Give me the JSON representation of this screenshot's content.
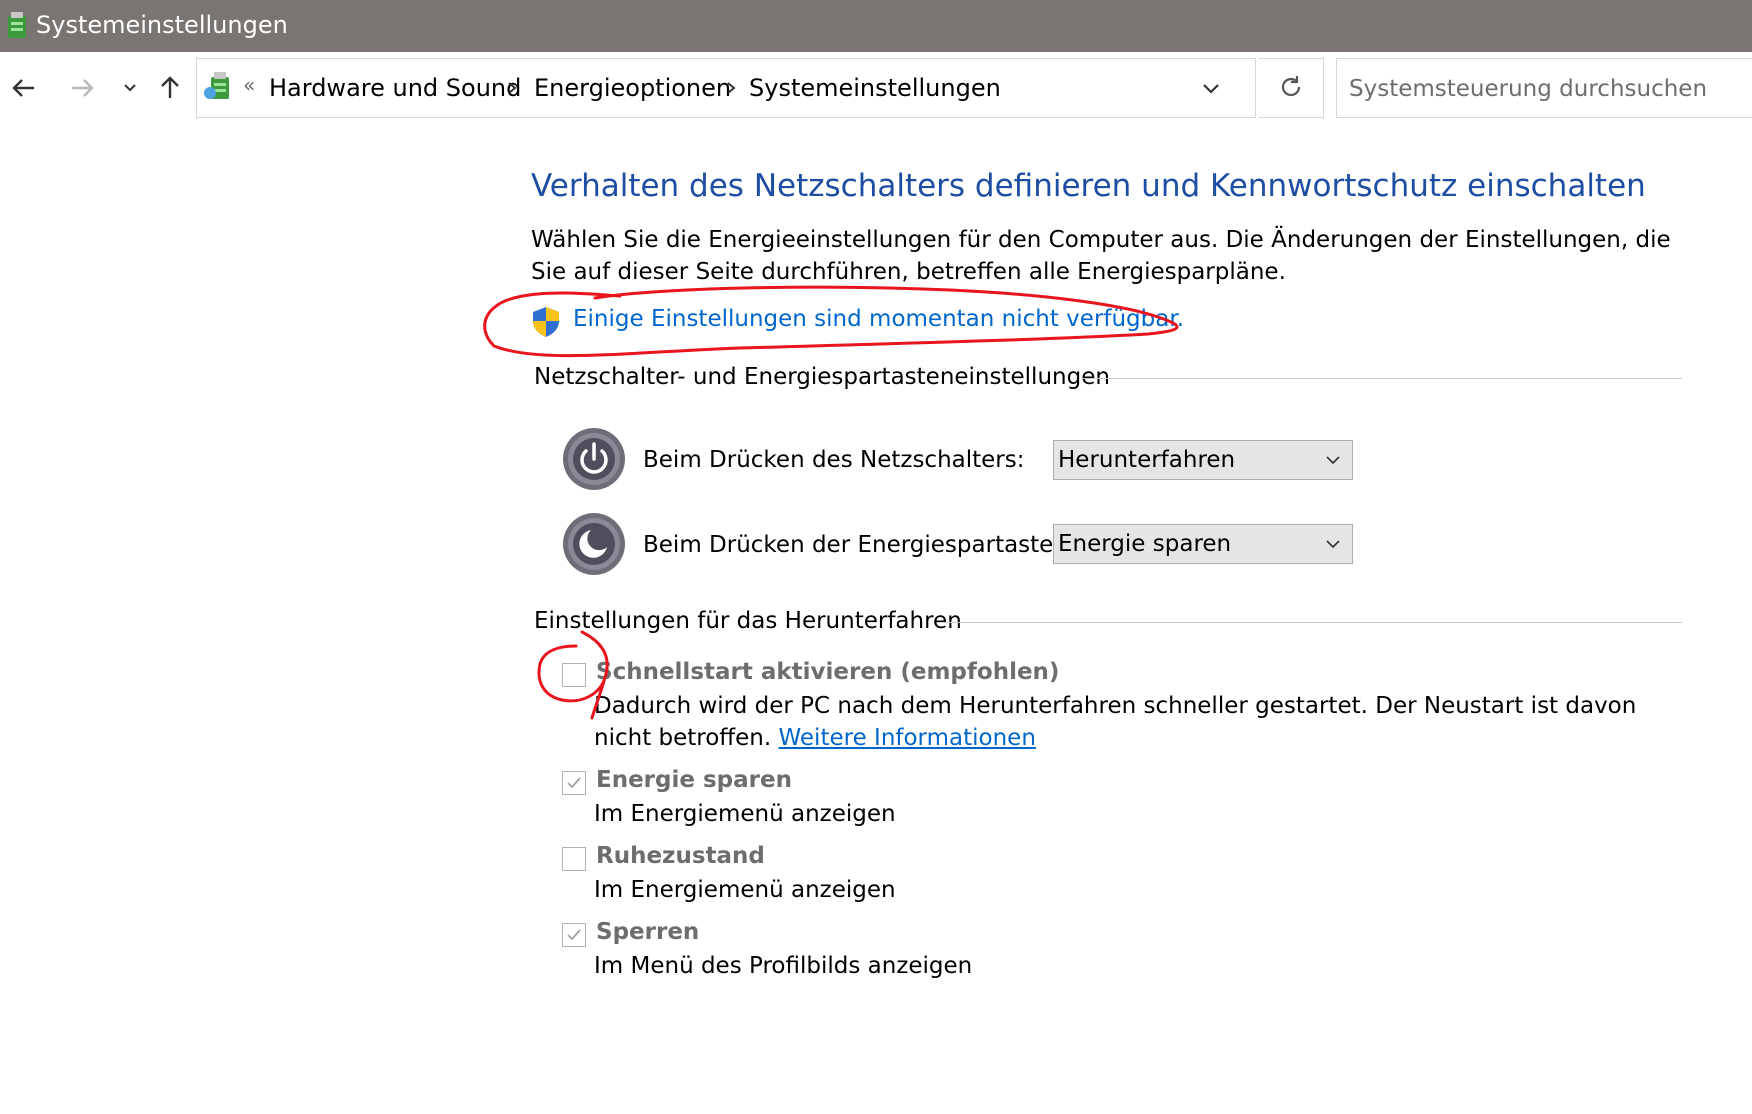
{
  "window": {
    "title": "Systemeinstellungen"
  },
  "nav": {
    "breadcrumb": [
      "Hardware und Sound",
      "Energieoptionen",
      "Systemeinstellungen"
    ],
    "search_placeholder": "Systemsteuerung durchsuchen"
  },
  "main": {
    "title": "Verhalten des Netzschalters definieren und Kennwortschutz einschalten",
    "description": "Wählen Sie die Energieeinstellungen für den Computer aus. Die Änderungen der Einstellungen, die Sie auf dieser Seite durchführen, betreffen alle Energiesparpläne.",
    "unavailable_link": "Einige Einstellungen sind momentan nicht verfügbar.",
    "power_section": {
      "heading": "Netzschalter- und Energiespartasteneinstellungen",
      "rows": [
        {
          "label": "Beim Drücken des Netzschalters:",
          "value": "Herunterfahren"
        },
        {
          "label": "Beim Drücken der Energiespartaste:",
          "value": "Energie sparen"
        }
      ]
    },
    "shutdown_section": {
      "heading": "Einstellungen für das Herunterfahren",
      "options": [
        {
          "label": "Schnellstart aktivieren (empfohlen)",
          "desc": "Dadurch wird der PC nach dem Herunterfahren schneller gestartet. Der Neustart ist davon nicht betroffen.",
          "link": "Weitere Informationen",
          "checked": false
        },
        {
          "label": "Energie sparen",
          "desc": "Im Energiemenü anzeigen",
          "checked": true
        },
        {
          "label": "Ruhezustand",
          "desc": "Im Energiemenü anzeigen",
          "checked": false
        },
        {
          "label": "Sperren",
          "desc": "Im Menü des Profilbilds anzeigen",
          "checked": true
        }
      ]
    }
  },
  "colors": {
    "titlebar": "#7a7573",
    "heading": "#1e4ea3",
    "link": "#0066cc",
    "annotation": "#e8141e"
  }
}
